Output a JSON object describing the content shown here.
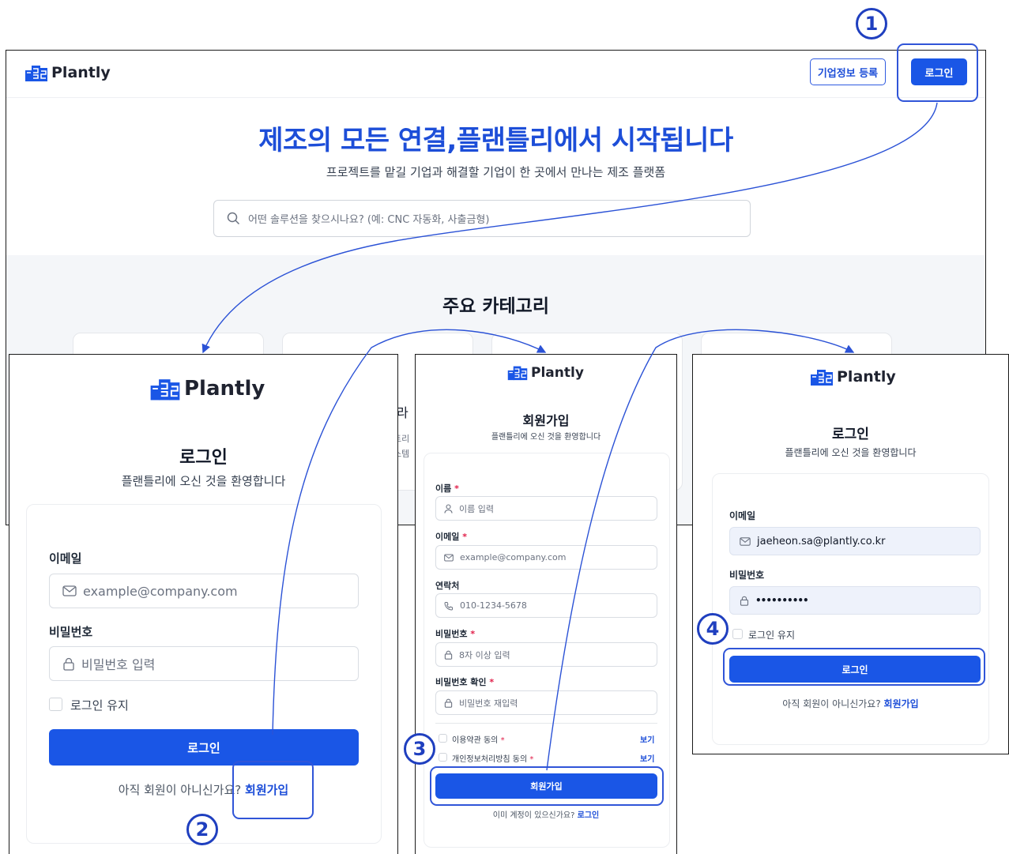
{
  "brand": {
    "name": "Plantly"
  },
  "colors": {
    "accent": "#1a56e6",
    "title_blue": "#1d4ed8",
    "highlight": "#3055d8",
    "required": "#e11d48"
  },
  "home": {
    "register_button": "기업정보 등록",
    "login_button": "로그인",
    "hero_title": "제조의 모든 연결,플랜틀리에서 시작됩니다",
    "hero_subtitle": "프로젝트를 맡길 기업과 해결할 기업이 한 곳에서 만나는 제조 플랫폼",
    "search_placeholder": "어떤 솔루션을 찾으시나요? (예: CNC 자동화, 사출금형)",
    "categories_title": "주요 카테고리",
    "peek_text_1": "라",
    "peek_text_2": "트리",
    "peek_text_3": "스템"
  },
  "login_empty": {
    "title": "로그인",
    "subtitle": "플랜틀리에 오신 것을 환영합니다",
    "email_label": "이메일",
    "email_placeholder": "example@company.com",
    "password_label": "비밀번호",
    "password_placeholder": "비밀번호 입력",
    "remember": "로그인 유지",
    "submit": "로그인",
    "signup_prompt": "아직 회원이 아니신가요?",
    "signup_link": "회원가입"
  },
  "signup": {
    "title": "회원가입",
    "subtitle": "플랜틀리에 오신 것을 환영합니다",
    "required_mark": "*",
    "name_label": "이름",
    "name_placeholder": "이름 입력",
    "email_label": "이메일",
    "email_placeholder": "example@company.com",
    "phone_label": "연락처",
    "phone_placeholder": "010-1234-5678",
    "password_label": "비밀번호",
    "password_placeholder": "8자 이상 입력",
    "confirm_label": "비밀번호 확인",
    "confirm_placeholder": "비밀번호 재입력",
    "terms_label": "이용약관 동의",
    "privacy_label": "개인정보처리방침 동의",
    "view_link": "보기",
    "submit": "회원가입",
    "login_prompt": "이미 계정이 있으신가요?",
    "login_link": "로그인"
  },
  "login_filled": {
    "title": "로그인",
    "subtitle": "플랜틀리에 오신 것을 환영합니다",
    "email_label": "이메일",
    "email_value": "jaeheon.sa@plantly.co.kr",
    "password_label": "비밀번호",
    "password_value": "••••••••••",
    "remember": "로그인 유지",
    "submit": "로그인",
    "signup_prompt": "아직 회원이 아니신가요?",
    "signup_link": "회원가입"
  },
  "steps": [
    "1",
    "2",
    "3",
    "4"
  ]
}
